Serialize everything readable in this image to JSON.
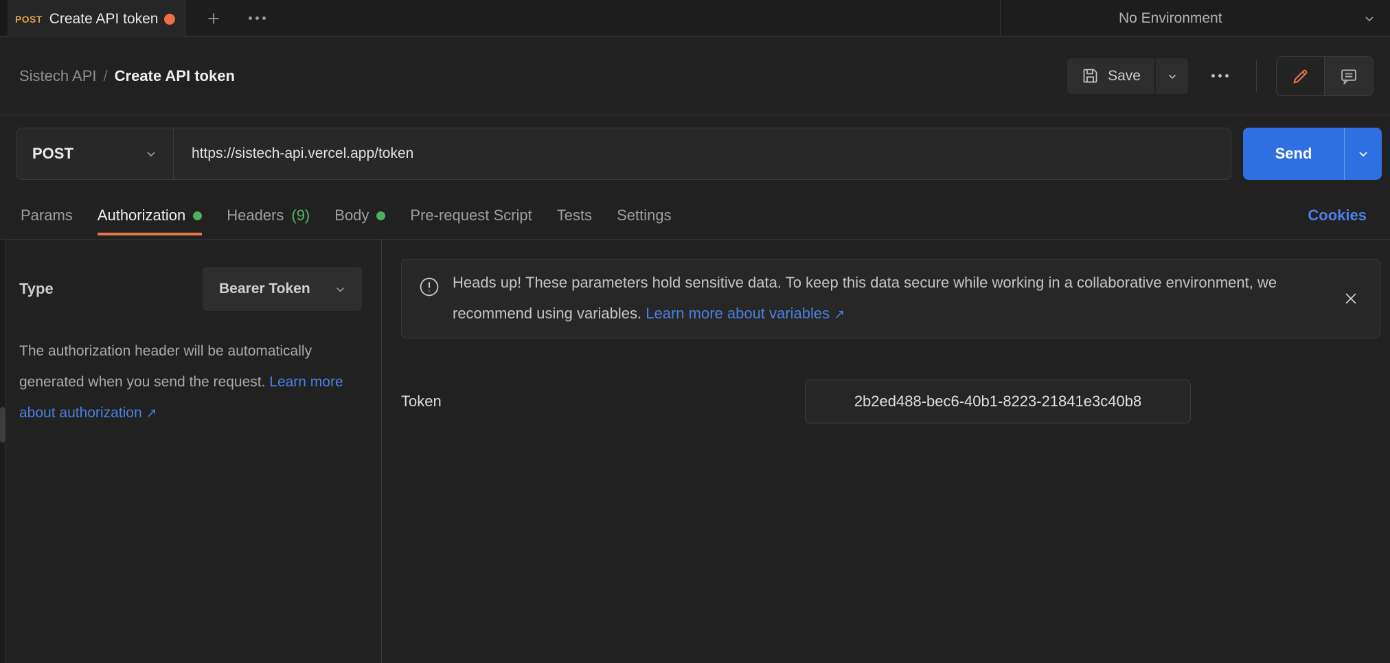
{
  "topbar": {
    "tab": {
      "method": "POST",
      "title": "Create API token"
    },
    "environment": {
      "selected": "No Environment"
    }
  },
  "header": {
    "breadcrumb": {
      "collection": "Sistech API",
      "separator": "/",
      "request": "Create API token"
    },
    "save_label": "Save"
  },
  "request_bar": {
    "method": "POST",
    "url": "https://sistech-api.vercel.app/token",
    "send_label": "Send"
  },
  "tabs": {
    "items": [
      {
        "label": "Params"
      },
      {
        "label": "Authorization"
      },
      {
        "label": "Headers",
        "count": "(9)"
      },
      {
        "label": "Body"
      },
      {
        "label": "Pre-request Script"
      },
      {
        "label": "Tests"
      },
      {
        "label": "Settings"
      }
    ],
    "cookies_link": "Cookies"
  },
  "auth_panel": {
    "type_label": "Type",
    "type_value": "Bearer Token",
    "description": "The authorization header will be automatically generated when you send the request. ",
    "description_link": "Learn more about authorization",
    "link_arrow": "↗"
  },
  "auth_content": {
    "banner": {
      "text": "Heads up! These parameters hold sensitive data. To keep this data secure while working in a collaborative environment, we recommend using variables. ",
      "link": "Learn more about variables",
      "link_arrow": "↗"
    },
    "token_label": "Token",
    "token_value": "2b2ed488-bec6-40b1-8223-21841e3c40b8"
  },
  "colors": {
    "accent_orange": "#ed764a",
    "method_post": "#d9a24c",
    "success_green": "#4db05f",
    "link_blue": "#4a80e0",
    "send_blue": "#2e70e2"
  }
}
